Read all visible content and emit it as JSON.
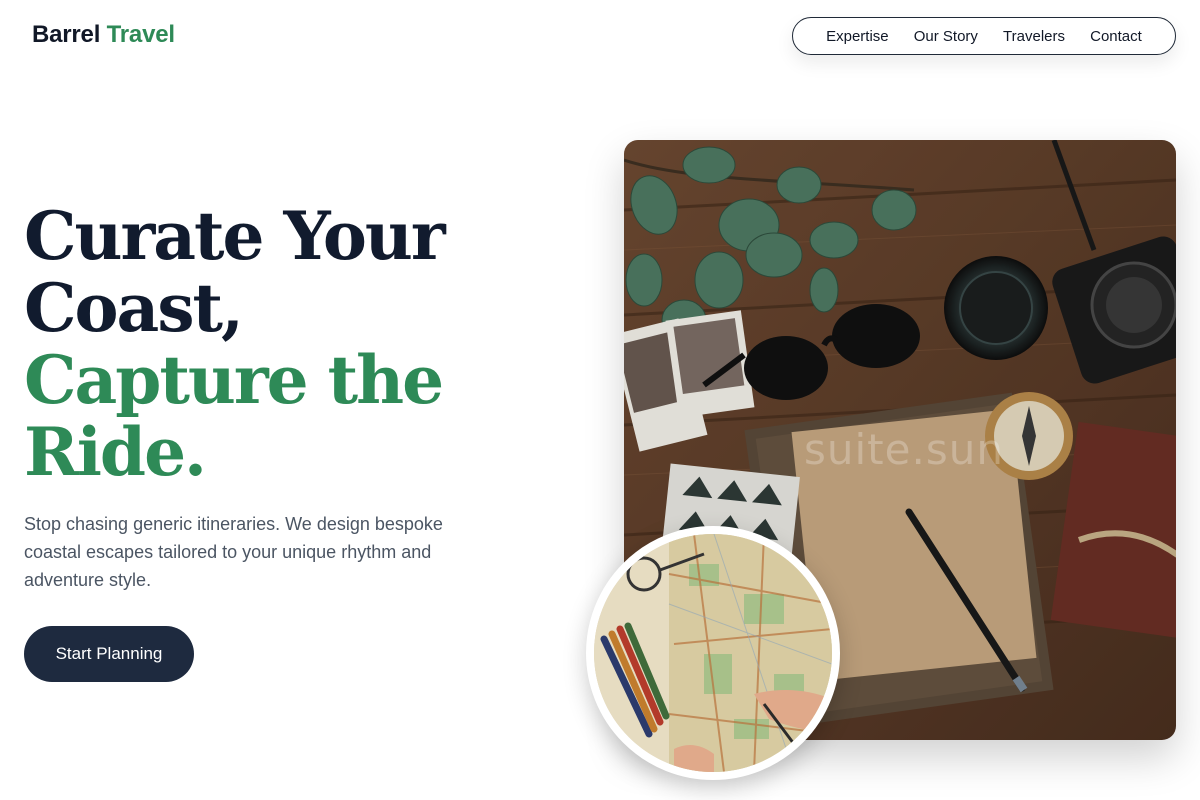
{
  "brand": {
    "name_part1": "Barrel",
    "name_part2": "Travel",
    "accent_color": "#2e8a57"
  },
  "nav": {
    "items": [
      {
        "label": "Expertise"
      },
      {
        "label": "Our Story"
      },
      {
        "label": "Travelers"
      },
      {
        "label": "Contact"
      }
    ]
  },
  "hero": {
    "headline_line1": "Curate Your",
    "headline_line2": "Coast,",
    "headline_line3": "Capture the",
    "headline_line4": "Ride.",
    "subtitle": "Stop chasing generic itineraries. We design bespoke coastal escapes tailored to your unique rhythm and adventure style.",
    "cta_label": "Start Planning",
    "cta_color": "#1e2a3f",
    "headline_color": "#111b2e"
  },
  "images": {
    "main_photo": "travel-flatlay-photo",
    "map_photo": "map-planning-photo",
    "watermark": "suite.sun"
  }
}
